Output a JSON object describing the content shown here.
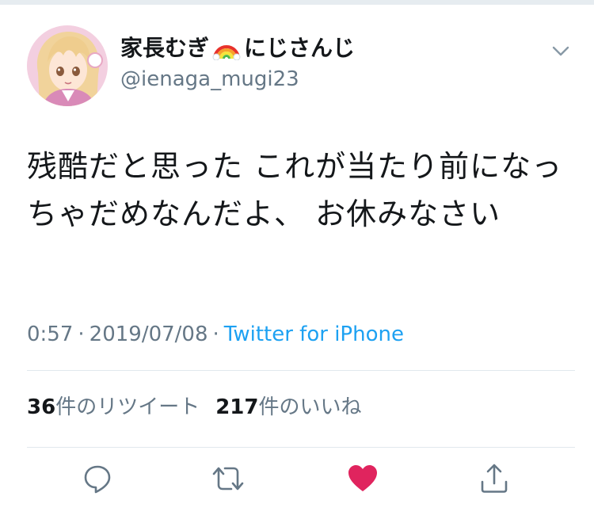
{
  "author": {
    "name_prefix": "家長むぎ",
    "name_suffix": "にじさんじ",
    "handle": "@ienaga_mugi23",
    "avatar_icon": "anime-girl-avatar"
  },
  "tweet": {
    "text": "残酷だと思った これが当たり前になっちゃだめなんだよ、 お休みなさい",
    "time": "0:57",
    "separator": "·",
    "date": "2019/07/08",
    "source": "Twitter for iPhone"
  },
  "stats": {
    "retweet_count": "36",
    "retweet_label": "件のリツイート",
    "like_count": "217",
    "like_label": "件のいいね"
  },
  "actions": {
    "reply_icon": "reply-icon",
    "retweet_icon": "retweet-icon",
    "like_icon": "heart-icon",
    "share_icon": "share-icon",
    "liked": true
  },
  "colors": {
    "text": "#14171a",
    "secondary": "#657786",
    "link": "#1da1f2",
    "like": "#e0245e",
    "icon": "#657786",
    "divider": "#e1e8ed"
  }
}
